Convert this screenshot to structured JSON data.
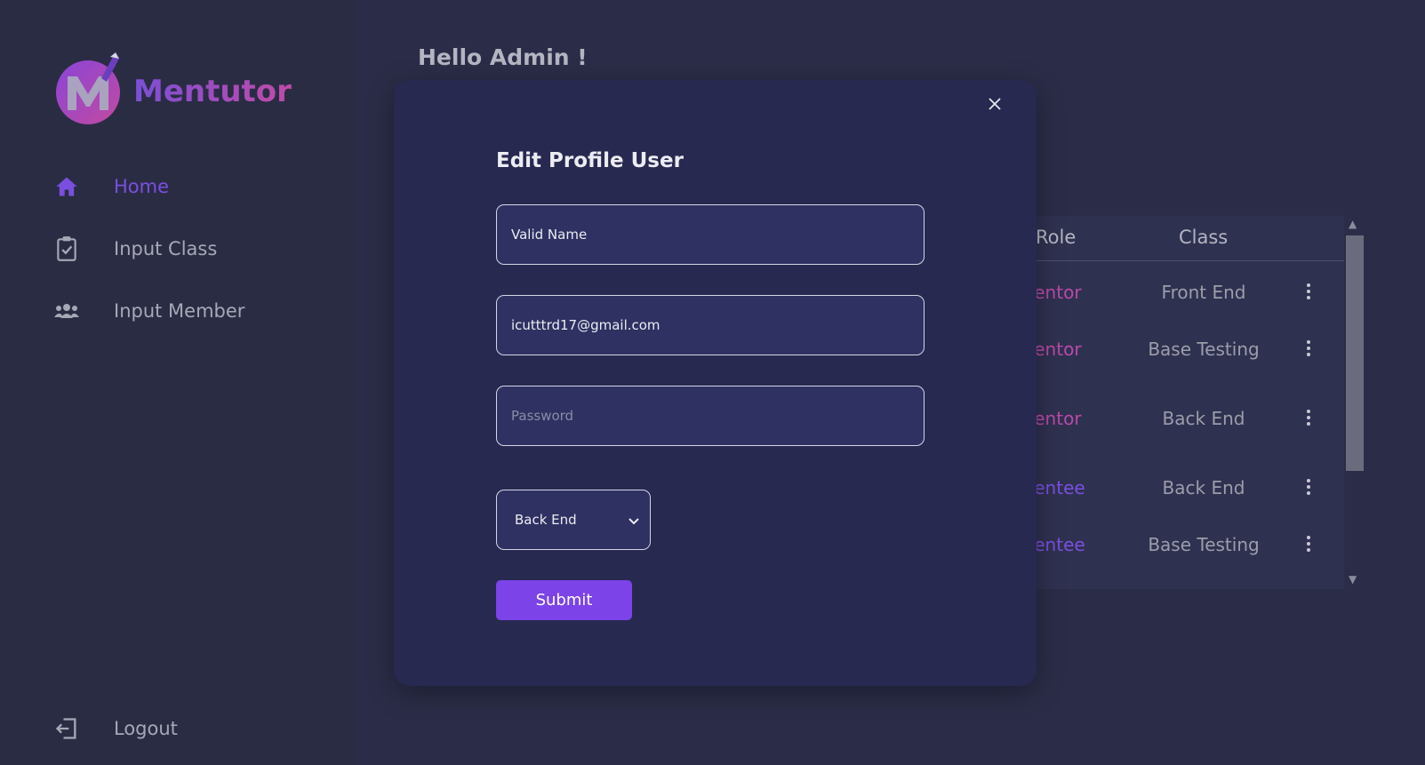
{
  "app": {
    "name": "Mentutor"
  },
  "sidebar": {
    "items": [
      {
        "label": "Home",
        "icon": "home-icon",
        "active": true
      },
      {
        "label": "Input Class",
        "icon": "clipboard-check-icon"
      },
      {
        "label": "Input Member",
        "icon": "users-icon"
      }
    ],
    "logout": {
      "label": "Logout",
      "icon": "logout-icon"
    }
  },
  "main": {
    "greeting": "Hello Admin !"
  },
  "table": {
    "headers": {
      "role": "Role",
      "class": "Class"
    },
    "rows": [
      {
        "role": "Mentor",
        "class": "Front End"
      },
      {
        "role": "Mentor",
        "class": "Base Testing"
      },
      {
        "role": "Mentor",
        "class": "Back End"
      },
      {
        "role": "Mentee",
        "class": "Back End"
      },
      {
        "role": "Mentee",
        "class": "Base Testing"
      }
    ]
  },
  "modal": {
    "title": "Edit Profile User",
    "name_value": "Valid Name",
    "email_value": "icutttrd17@gmail.com",
    "password_placeholder": "Password",
    "class_select": "Back End",
    "submit_label": "Submit"
  },
  "colors": {
    "accent": "#7c43e8",
    "mentor": "#b94aa8",
    "mentee": "#7a4fe0",
    "background": "#2b2d48",
    "modal": "#272950"
  }
}
